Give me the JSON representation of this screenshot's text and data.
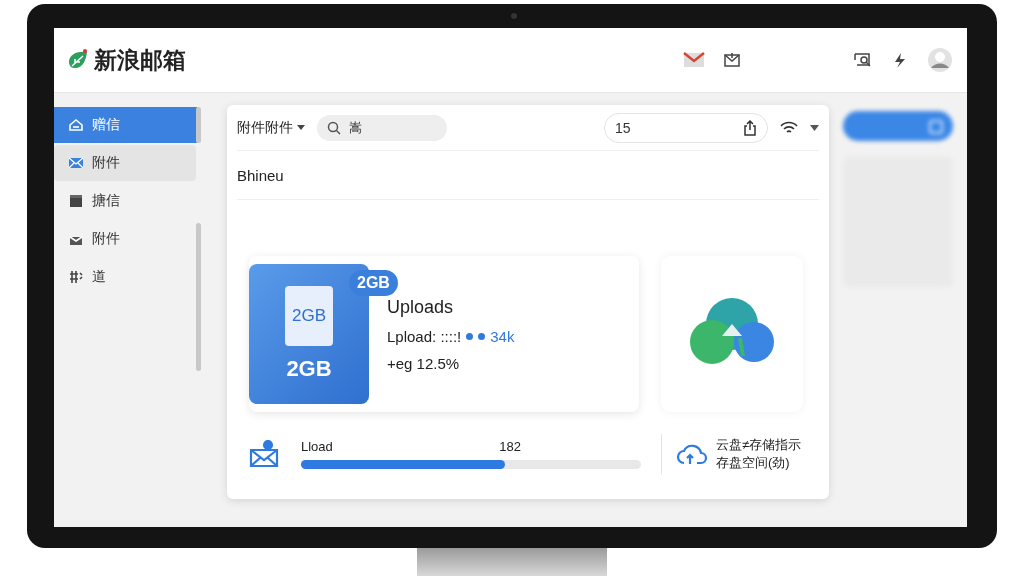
{
  "header": {
    "logo": "新浪邮箱"
  },
  "sidebar": {
    "items": [
      {
        "label": "赠信",
        "selected": true,
        "hovered": false
      },
      {
        "label": "附件",
        "selected": false,
        "hovered": true
      },
      {
        "label": "搪信",
        "selected": false,
        "hovered": false
      },
      {
        "label": "附件",
        "selected": false,
        "hovered": false
      },
      {
        "label": "道",
        "selected": false,
        "hovered": false
      }
    ]
  },
  "toolbar": {
    "folder": "附件附件",
    "search": {
      "value": "嵩"
    },
    "count": {
      "value": "15"
    }
  },
  "subject": "Bhineu",
  "upload": {
    "badge": "2GB",
    "file_label": "2GB",
    "size": "2GB",
    "title": "Uploads",
    "status": "Lpload: ::::!",
    "speed": "34k",
    "percent": "+eg 12.5%"
  },
  "progress": {
    "label": "Lload",
    "value": "182",
    "level": 0.6
  },
  "storage": {
    "lines": [
      "云盘≠存储指示",
      "存盘空间(劲)"
    ]
  }
}
